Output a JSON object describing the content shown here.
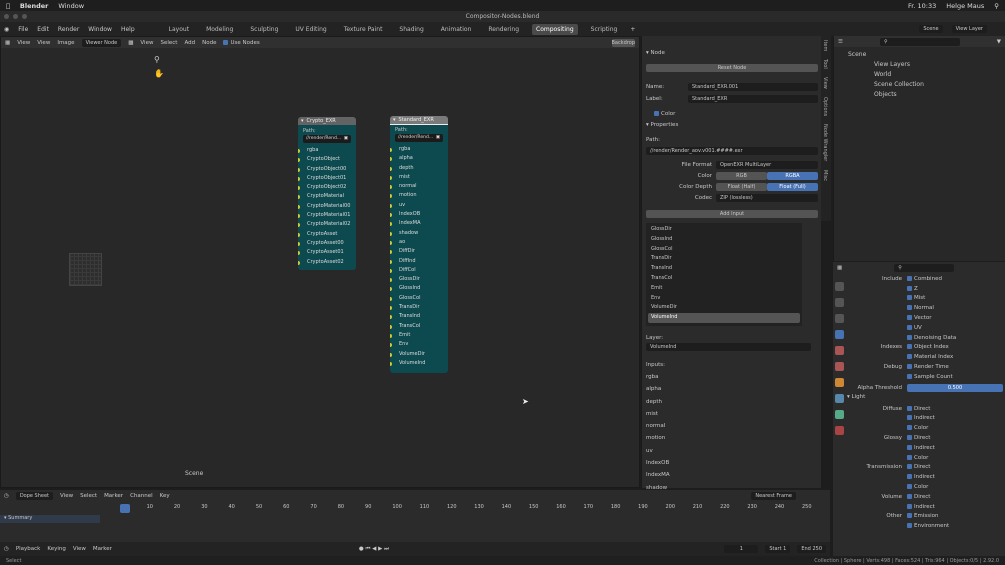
{
  "os": {
    "app": "Blender",
    "menu": "Window",
    "clock": "Fr. 10:33",
    "user": "Helge Maus"
  },
  "window_title": "Compositor-Nodes.blend",
  "menu": [
    "File",
    "Edit",
    "Render",
    "Window",
    "Help"
  ],
  "workspaces": [
    "Layout",
    "Modeling",
    "Sculpting",
    "UV Editing",
    "Texture Paint",
    "Shading",
    "Animation",
    "Rendering",
    "Compositing",
    "Scripting"
  ],
  "active_workspace": "Compositing",
  "scene": "Scene",
  "view_layer": "View Layer",
  "node_editor": {
    "header": {
      "view": "View",
      "view2": "View",
      "image": "Image",
      "viewer_node": "Viewer Node",
      "select": "Select",
      "add": "Add",
      "node": "Node",
      "use_nodes": "Use Nodes",
      "backdrop": "Backdrop"
    },
    "scene_label": "Scene",
    "crypto": {
      "title": "Crypto_EXR",
      "path_label": "Path:",
      "path": "//render/Rend...",
      "sockets": [
        "rgba",
        "CryptoObject",
        "CryptoObject00",
        "CryptoObject01",
        "CryptoObject02",
        "CryptoMaterial",
        "CryptoMaterial00",
        "CryptoMaterial01",
        "CryptoMaterial02",
        "CryptoAsset",
        "CryptoAsset00",
        "CryptoAsset01",
        "CryptoAsset02"
      ]
    },
    "standard": {
      "title": "Standard_EXR",
      "path_label": "Path:",
      "path": "//render/Rend...",
      "sockets": [
        "rgba",
        "alpha",
        "depth",
        "mist",
        "normal",
        "motion",
        "uv",
        "IndexOB",
        "IndexMA",
        "shadow",
        "ao",
        "DiffDir",
        "DiffInd",
        "DiffCol",
        "GlossDir",
        "GlossInd",
        "GlossCol",
        "TransDir",
        "TransInd",
        "TransCol",
        "Emit",
        "Env",
        "VolumeDir",
        "VolumeInd"
      ]
    }
  },
  "sidebar": {
    "node_section": "Node",
    "reset_node": "Reset Node",
    "name_label": "Name:",
    "name_value": "Standard_EXR.001",
    "label_label": "Label:",
    "label_value": "Standard_EXR",
    "color_label": "Color",
    "properties": "Properties",
    "path_label": "Path:",
    "path_value": "//render/Render_aov.v001.####.exr",
    "file_format_label": "File Format",
    "file_format": "OpenEXR MultiLayer",
    "color_mode_label": "Color",
    "color_rgb": "RGB",
    "color_rgba": "RGBA",
    "depth_label": "Color Depth",
    "depth_half": "Float (Half)",
    "depth_full": "Float (Full)",
    "codec_label": "Codec",
    "codec": "ZIP (lossless)",
    "add_input": "Add Input",
    "list": [
      "GlossDir",
      "GlossInd",
      "GlossCol",
      "TransDir",
      "TransInd",
      "TransCol",
      "Emit",
      "Env",
      "VolumeDir",
      "VolumeInd"
    ],
    "layer_label": "Layer:",
    "layer_value": "VolumeInd",
    "inputs_label": "Inputs:",
    "inputs": [
      "rgba",
      "alpha",
      "depth",
      "mist",
      "normal",
      "motion",
      "uv",
      "IndexOB",
      "IndexMA",
      "shadow"
    ],
    "tabs": [
      "Item",
      "Tool",
      "View",
      "Options",
      "Node Wrangler",
      "Misc"
    ]
  },
  "outliner": {
    "items": [
      "Scene",
      "View Layers",
      "World",
      "Scene Collection",
      "Objects"
    ]
  },
  "view_layer_props": {
    "include_label": "Include",
    "include": [
      "Combined",
      "Z",
      "Mist",
      "Normal",
      "Vector",
      "UV",
      "Denoising Data"
    ],
    "indexes_label": "Indexes",
    "indexes": [
      "Object Index",
      "Material Index"
    ],
    "debug_label": "Debug",
    "debug": [
      "Render Time",
      "Sample Count"
    ],
    "alpha_threshold_label": "Alpha Threshold",
    "alpha_threshold": "0.500",
    "light": "Light",
    "diffuse_label": "Diffuse",
    "glossy_label": "Glossy",
    "transmission_label": "Transmission",
    "volume_label": "Volume",
    "other_label": "Other",
    "dit": [
      "Direct",
      "Indirect",
      "Color"
    ],
    "di": [
      "Direct",
      "Indirect"
    ],
    "other": [
      "Emission",
      "Environment"
    ]
  },
  "dope": {
    "mode": "Dope Sheet",
    "menus": [
      "View",
      "Select",
      "Marker",
      "Channel",
      "Key"
    ],
    "summary": "Summary",
    "snap": "Nearest Frame",
    "ticks": [
      "1",
      "10",
      "20",
      "30",
      "40",
      "50",
      "60",
      "70",
      "80",
      "90",
      "100",
      "110",
      "120",
      "130",
      "140",
      "150",
      "160",
      "170",
      "180",
      "190",
      "200",
      "210",
      "220",
      "230",
      "240",
      "250"
    ]
  },
  "timeline": {
    "menus": [
      "Playback",
      "Keying",
      "View",
      "Marker"
    ],
    "frame": "1",
    "start_label": "Start",
    "start": "1",
    "end_label": "End",
    "end": "250"
  },
  "status": {
    "left": "Select",
    "right": "Collection | Sphere | Verts:498 | Faces:524 | Tris:964 | Objects:0/5 | 2.92.0"
  }
}
